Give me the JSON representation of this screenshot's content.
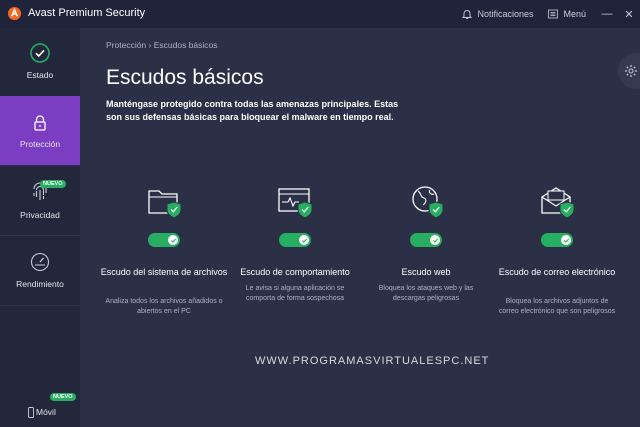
{
  "titlebar": {
    "app_title": "Avast Premium Security",
    "notifications_label": "Notificaciones",
    "menu_label": "Menú",
    "minimize_glyph": "—",
    "close_glyph": "✕"
  },
  "sidebar": {
    "items": [
      {
        "label": "Estado",
        "icon": "check-circle-icon"
      },
      {
        "label": "Protección",
        "icon": "lock-icon",
        "active": true
      },
      {
        "label": "Privacidad",
        "icon": "fingerprint-icon",
        "badge": "NUEVO"
      },
      {
        "label": "Rendimiento",
        "icon": "speedometer-icon"
      },
      {
        "label": "Móvil",
        "icon": "phone-icon",
        "badge": "NUEVO"
      }
    ]
  },
  "breadcrumb": "Protección › Escudos básicos",
  "page": {
    "title": "Escudos básicos",
    "description": "Manténgase protegido contra todas las amenazas principales. Estas son sus defensas básicas para bloquear el malware en tiempo real."
  },
  "shields": [
    {
      "title": "Escudo del sistema de archivos",
      "description": "Analiza todos los archivos añadidos o abiertos en el PC",
      "icon": "folder-shield-icon",
      "enabled": true
    },
    {
      "title": "Escudo de comportamiento",
      "description": "Le avisa si alguna aplicación se comporta de forma sospechosa",
      "icon": "activity-window-icon",
      "enabled": true
    },
    {
      "title": "Escudo web",
      "description": "Bloquea los ataques web y las descargas peligrosas",
      "icon": "globe-icon",
      "enabled": true
    },
    {
      "title": "Escudo de correo electrónico",
      "description": "Bloquea los archivos adjuntos de correo electrónico que son peligrosos",
      "icon": "envelope-icon",
      "enabled": true
    }
  ],
  "watermark": "WWW.PROGRAMASVIRTUALESPC.NET",
  "colors": {
    "background": "#2b3046",
    "sidebar": "#23273b",
    "accent_purple": "#7b3ec2",
    "toggle_green": "#27ae60",
    "logo_orange": "#f26722"
  }
}
